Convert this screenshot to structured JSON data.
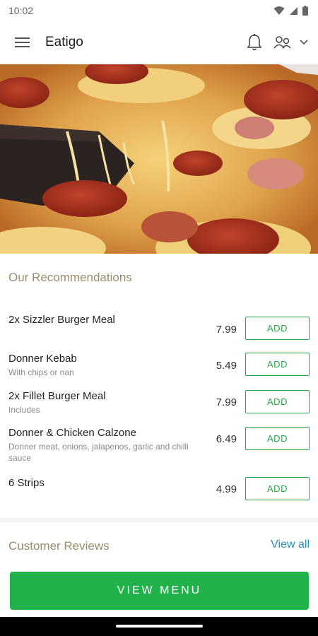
{
  "status_bar": {
    "time": "10:02"
  },
  "app_bar": {
    "title": "Eatigo"
  },
  "hero": {
    "image": "pepperoni-pizza-photo"
  },
  "recommendations": {
    "title": "Our Recommendations",
    "items": [
      {
        "name": "2x Sizzler Burger Meal",
        "description": "",
        "price": "7.99",
        "button": "ADD"
      },
      {
        "name": "Donner Kebab",
        "description": "With chips or nan",
        "price": "5.49",
        "button": "ADD"
      },
      {
        "name": "2x Fillet Burger Meal",
        "description": "Includes",
        "price": "7.99",
        "button": "ADD"
      },
      {
        "name": "Donner & Chicken Calzone",
        "description": "Donner meat, onions, jalapenos, garlic and chilli sauce",
        "price": "6.49",
        "button": "ADD"
      },
      {
        "name": "6 Strips",
        "description": "",
        "price": "4.99",
        "button": "ADD"
      }
    ]
  },
  "reviews": {
    "title": "Customer Reviews",
    "view_all": "View all"
  },
  "cta": {
    "label": "VIEW MENU"
  },
  "colors": {
    "accent_green": "#22b24c",
    "link_blue": "#2a8fbd",
    "section_title": "#9a8d6d"
  }
}
